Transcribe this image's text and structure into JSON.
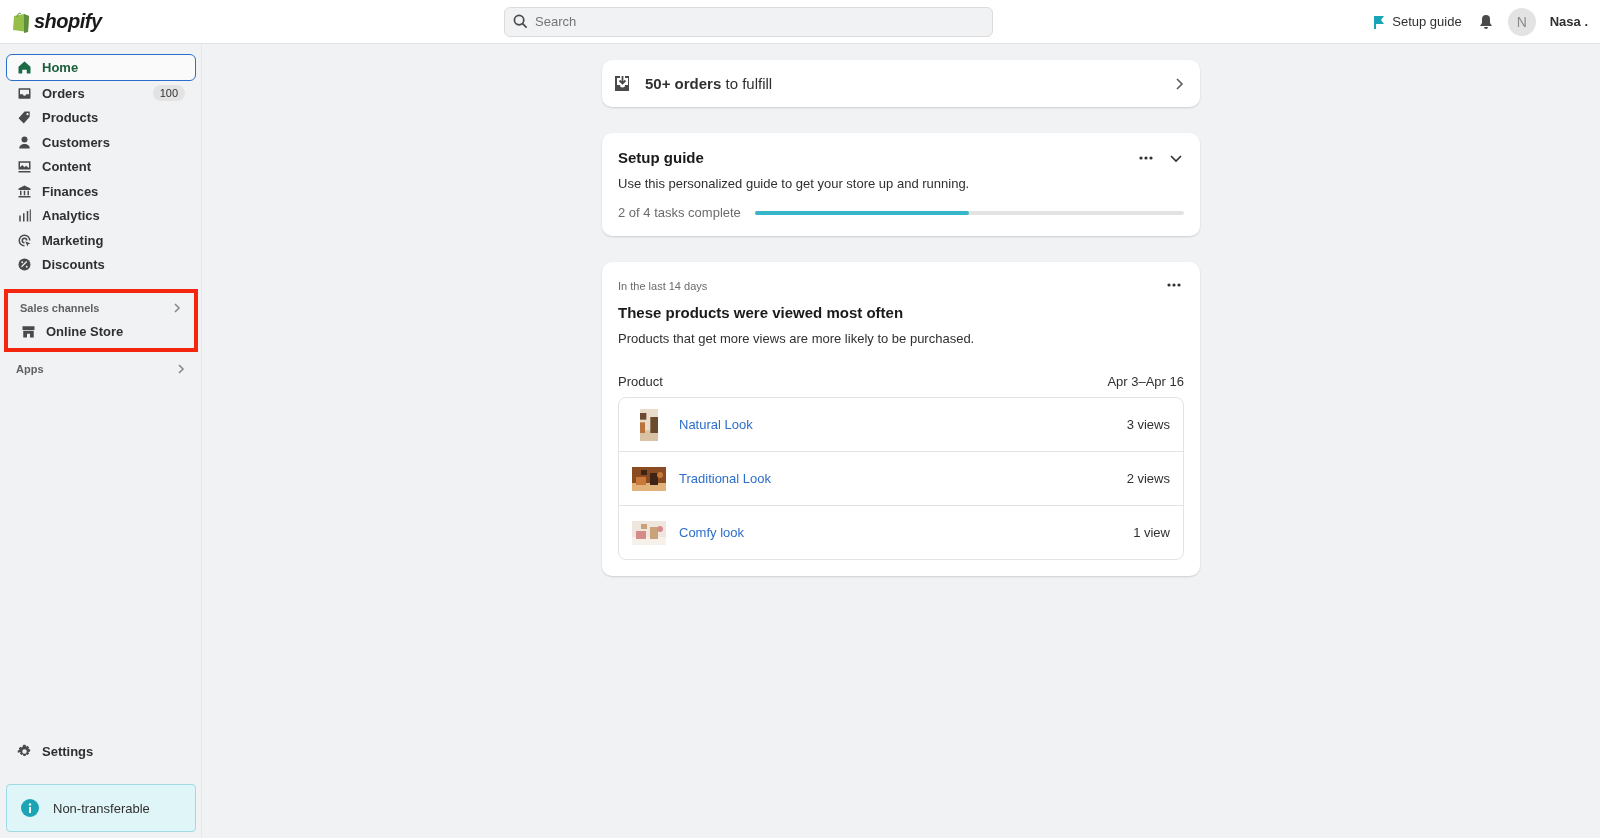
{
  "topbar": {
    "logo": "shopify",
    "search": {
      "placeholder": "Search"
    },
    "setup_guide": "Setup guide",
    "avatar": "N",
    "user": "Nasa ."
  },
  "sidebar": {
    "items": [
      {
        "label": "Home",
        "selected": true
      },
      {
        "label": "Orders",
        "selected": false,
        "badge": "100"
      },
      {
        "label": "Products",
        "selected": false
      },
      {
        "label": "Customers",
        "selected": false
      },
      {
        "label": "Content",
        "selected": false
      },
      {
        "label": "Finances",
        "selected": false
      },
      {
        "label": "Analytics",
        "selected": false
      },
      {
        "label": "Marketing",
        "selected": false
      },
      {
        "label": "Discounts",
        "selected": false
      }
    ],
    "sales_channels": {
      "title": "Sales channels",
      "highlighted": true,
      "items": [
        {
          "label": "Online Store",
          "selected": false
        }
      ]
    },
    "apps": {
      "title": "Apps"
    },
    "settings": "Settings",
    "notice": "Non-transferable"
  },
  "orders_card": {
    "text": "**50+ orders** to fulfill"
  },
  "setup_card": {
    "title": "Setup guide",
    "description": "Use this personalized guide to get your store up and running.",
    "progress_label": "2 of 4 tasks complete",
    "level": 0.5
  },
  "products_card": {
    "period": "In the last 14 days",
    "title": "These products were viewed most often",
    "description": "Products that get more views are more likely to be purchased.",
    "columns": [
      "Product",
      "Apr 3–Apr 16"
    ],
    "rows": [
      {
        "name": "Natural Look",
        "views": "3 views"
      },
      {
        "name": "Traditional Look",
        "views": "2 views"
      },
      {
        "name": "Comfy look",
        "views": "1 view"
      }
    ]
  }
}
